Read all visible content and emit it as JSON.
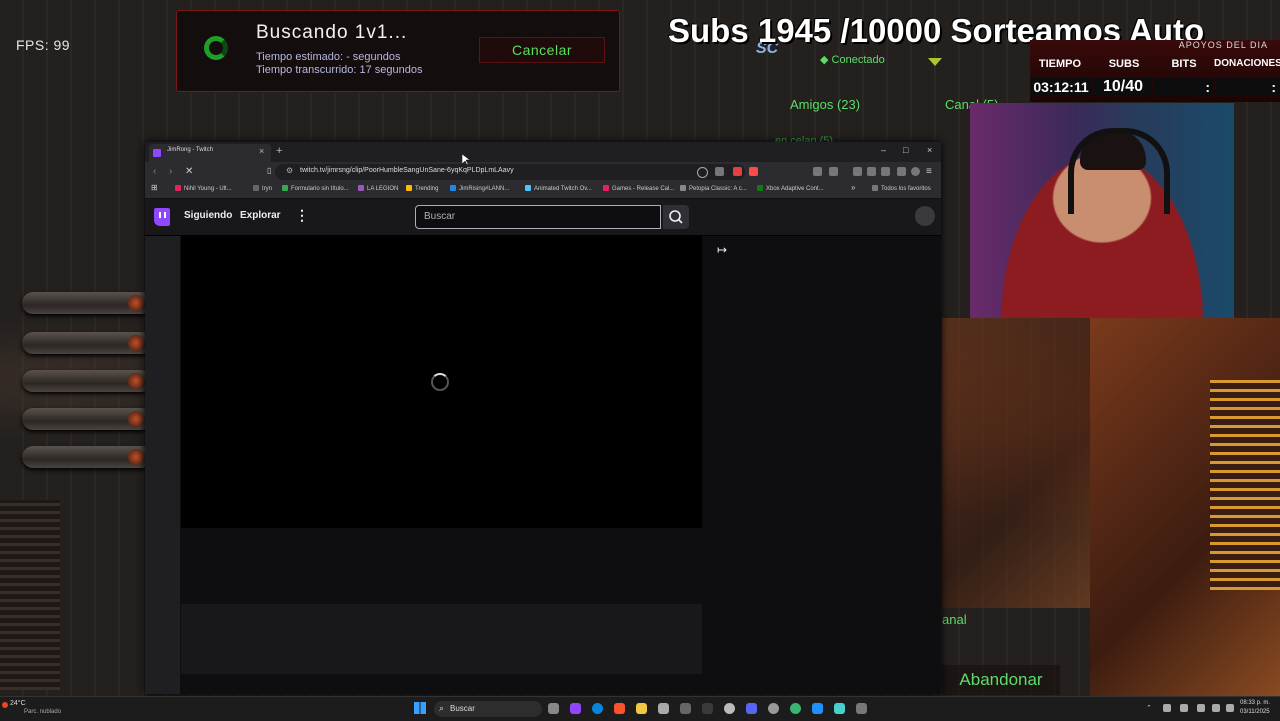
{
  "game": {
    "fps": "FPS: 99",
    "search_title": "Buscando 1v1...",
    "estimated": "Tiempo estimado: - segundos",
    "elapsed": "Tiempo transcurrido: 17 segundos",
    "cancel": "Cancelar",
    "connected": "Conectado",
    "friends": "Amigos (23)",
    "channel_tab": "Canal (5)",
    "online": "en celan (5)",
    "channel_side": "anal",
    "leave": "Abandonar",
    "logo": "SC"
  },
  "stream": {
    "banner": "Subs 1945 /10000 Sorteamos Auto",
    "header": "APOYOS DEL DIA",
    "cols": [
      "TIEMPO",
      "SUBS",
      "BITS",
      "DONACIONES"
    ],
    "vals": [
      "03:12:11",
      "10/40",
      ":",
      ":"
    ]
  },
  "browser": {
    "tab_title": "JimRong - Twitch",
    "tab_close": "×",
    "new_tab": "+",
    "url": "twitch.tv/jimrsng/clip/PoorHumbleSangUnSane-6yqKqPLDpLmLAavy",
    "bookmarks": [
      {
        "label": "Nihil Young - Ult...",
        "color": "#e0245e"
      },
      {
        "label": "tryn",
        "color": "#666"
      },
      {
        "label": "Formulario sin título...",
        "color": "#34a853"
      },
      {
        "label": "LA LEGION",
        "color": "#9b59b6"
      },
      {
        "label": "Trending",
        "color": "#fbbc05"
      },
      {
        "label": "JimRising#LANN...",
        "color": "#1e88e5"
      },
      {
        "label": "Animated Twitch Ov...",
        "color": "#4fc3f7"
      },
      {
        "label": "Games - Release Cal...",
        "color": "#e91e63"
      },
      {
        "label": "Petopia Classic: A c...",
        "color": "#888"
      },
      {
        "label": "Xbox Adaptive Cont...",
        "color": "#107c10"
      },
      {
        "label": "Todos los favoritos",
        "color": "#777"
      }
    ],
    "window_controls": [
      "–",
      "□",
      "×"
    ]
  },
  "twitch": {
    "following": "Siguiendo",
    "explore": "Explorar",
    "more": "⋮",
    "search_placeholder": "Buscar",
    "collapse": "↦"
  },
  "taskbar": {
    "weather": "24°C",
    "weather_sub": "Parc. nublado",
    "search": "Buscar",
    "time": "08:33 p. m.",
    "date": "03/11/2025"
  },
  "colors": {
    "twitch": "#9146ff",
    "game_green": "#5edc6a",
    "panel_border": "#7a1818"
  }
}
